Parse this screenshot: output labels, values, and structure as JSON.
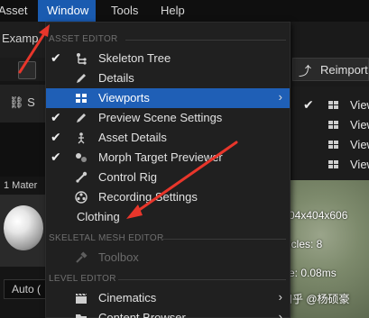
{
  "menubar": {
    "items": [
      {
        "label": "Asset",
        "active": false
      },
      {
        "label": "Window",
        "active": true
      },
      {
        "label": "Tools",
        "active": false
      },
      {
        "label": "Help",
        "active": false
      }
    ]
  },
  "background": {
    "tab_label": "Examp",
    "subtab_label": "S",
    "material_label": "1 Mater",
    "auto_label": "Auto (",
    "reimport_label": "Reimport",
    "viewports_submenu": [
      {
        "label": "View",
        "checked": true
      },
      {
        "label": "View",
        "checked": false
      },
      {
        "label": "View",
        "checked": false
      },
      {
        "label": "View",
        "checked": false
      }
    ],
    "viewport_stats": [
      {
        "text": "04x404x606"
      },
      {
        "text": "icles: 8"
      },
      {
        "text": "e: 0.08ms"
      }
    ],
    "watermark": "知乎 @杨硕豪"
  },
  "menu": {
    "sections": [
      {
        "header": "ASSET EDITOR",
        "items": [
          {
            "label": "Skeleton Tree",
            "checked": true,
            "icon": "skeleton-tree-icon",
            "submenu": false,
            "highlighted": false,
            "disabled": false
          },
          {
            "label": "Details",
            "checked": false,
            "icon": "details-pencil-icon",
            "submenu": false,
            "highlighted": false,
            "disabled": false
          },
          {
            "label": "Viewports",
            "checked": false,
            "icon": "viewports-grid-icon",
            "submenu": true,
            "highlighted": true,
            "disabled": false
          },
          {
            "label": "Preview Scene Settings",
            "checked": true,
            "icon": "preview-pencil-icon",
            "submenu": false,
            "highlighted": false,
            "disabled": false
          },
          {
            "label": "Asset Details",
            "checked": true,
            "icon": "asset-details-icon",
            "submenu": false,
            "highlighted": false,
            "disabled": false
          },
          {
            "label": "Morph Target Previewer",
            "checked": true,
            "icon": "morph-target-icon",
            "submenu": false,
            "highlighted": false,
            "disabled": false
          },
          {
            "label": "Control Rig",
            "checked": false,
            "icon": "control-rig-icon",
            "submenu": false,
            "highlighted": false,
            "disabled": false
          },
          {
            "label": "Recording Settings",
            "checked": false,
            "icon": "recording-icon",
            "submenu": false,
            "highlighted": false,
            "disabled": false
          },
          {
            "label": "Clothing",
            "checked": false,
            "icon": "",
            "submenu": false,
            "highlighted": false,
            "disabled": false
          }
        ]
      },
      {
        "header": "SKELETAL MESH EDITOR",
        "items": [
          {
            "label": "Toolbox",
            "checked": false,
            "icon": "toolbox-hammer-icon",
            "submenu": false,
            "highlighted": false,
            "disabled": true
          }
        ]
      },
      {
        "header": "LEVEL EDITOR",
        "items": [
          {
            "label": "Cinematics",
            "checked": false,
            "icon": "cinematics-clapper-icon",
            "submenu": true,
            "highlighted": false,
            "disabled": false
          },
          {
            "label": "Content Browser",
            "checked": false,
            "icon": "content-browser-icon",
            "submenu": true,
            "highlighted": false,
            "disabled": false
          }
        ]
      }
    ]
  },
  "colors": {
    "menu_highlight": "#1f5fb6",
    "menubar_active": "#1a5bb0",
    "annotation_red": "#e8362b"
  }
}
